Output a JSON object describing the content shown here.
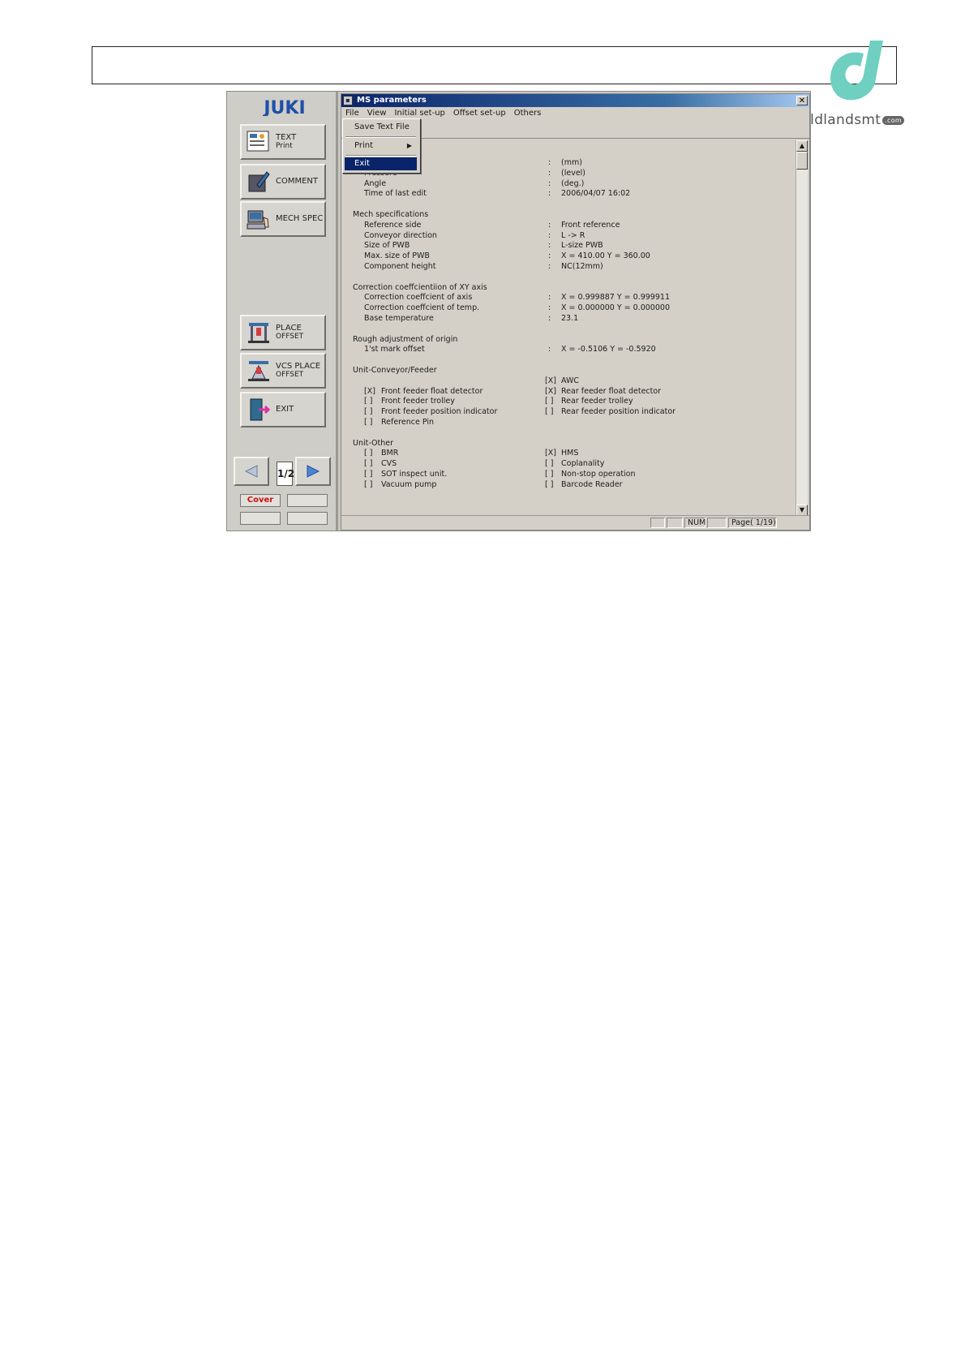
{
  "brand": {
    "name": "Goldlandsmt",
    "suffix": ".com"
  },
  "left_panel": {
    "logo": "JUKI",
    "buttons": [
      {
        "line1": "TEXT",
        "line2": "Print",
        "icon": "text-print-icon"
      },
      {
        "line1": "COMMENT",
        "line2": "",
        "icon": "comment-icon"
      },
      {
        "line1": "MECH SPEC",
        "line2": "",
        "icon": "mech-spec-icon"
      },
      {
        "line1": "PLACE",
        "line2": "OFFSET",
        "icon": "place-offset-icon"
      },
      {
        "line1": "VCS PLACE",
        "line2": "OFFSET",
        "icon": "vcs-place-offset-icon"
      },
      {
        "line1": "EXIT",
        "line2": "",
        "icon": "exit-door-icon"
      }
    ],
    "page_indicator": "1/2",
    "status": {
      "cover": "Cover"
    }
  },
  "window": {
    "title": "MS parameters",
    "menu": [
      "File",
      "View",
      "Initial set-up",
      "Offset set-up",
      "Others"
    ],
    "file_menu": {
      "save": "Save Text File",
      "print": "Print",
      "exit": "Exit"
    },
    "lines": [
      {
        "type": "kv",
        "label": "",
        "value": "(mm)"
      },
      {
        "type": "kv",
        "label": "Pressure",
        "value": "(level)"
      },
      {
        "type": "kv",
        "label": "Angle",
        "value": "(deg.)"
      },
      {
        "type": "kv",
        "label": "Time of last edit",
        "value": "2006/04/07 16:02"
      },
      {
        "type": "blank"
      },
      {
        "type": "section",
        "label": "Mech specifications"
      },
      {
        "type": "kv",
        "label": "Reference side",
        "value": "Front reference"
      },
      {
        "type": "kv",
        "label": "Conveyor direction",
        "value": "L -> R"
      },
      {
        "type": "kv",
        "label": "Size of PWB",
        "value": "L-size PWB"
      },
      {
        "type": "kv",
        "label": "Max. size of PWB",
        "value": "X =  410.00  Y =  360.00"
      },
      {
        "type": "kv",
        "label": "Component height",
        "value": "NC(12mm)"
      },
      {
        "type": "blank"
      },
      {
        "type": "section",
        "label": "Correction coeffcientiion of XY axis"
      },
      {
        "type": "kv",
        "label": "Correction coeffcient of axis",
        "value": "X = 0.999887  Y = 0.999911"
      },
      {
        "type": "kv",
        "label": "Correction coeffcient of temp.",
        "value": "X = 0.000000  Y = 0.000000"
      },
      {
        "type": "kv",
        "label": "Base temperature",
        "value": "23.1"
      },
      {
        "type": "blank"
      },
      {
        "type": "section",
        "label": "Rough adjustment of origin"
      },
      {
        "type": "kv",
        "label": "1'st mark offset",
        "value": "X =  -0.5106  Y =  -0.5920"
      },
      {
        "type": "blank"
      },
      {
        "type": "section",
        "label": "Unit-Conveyor/Feeder"
      },
      {
        "type": "chk",
        "l_mark": "",
        "l_label": "",
        "r_mark": "[X]",
        "r_label": "AWC"
      },
      {
        "type": "chk",
        "l_mark": "[X]",
        "l_label": "Front feeder float detector",
        "r_mark": "[X]",
        "r_label": "Rear feeder float detector"
      },
      {
        "type": "chk",
        "l_mark": "[  ]",
        "l_label": "Front feeder trolley",
        "r_mark": "[  ]",
        "r_label": "Rear feeder trolley"
      },
      {
        "type": "chk",
        "l_mark": "[  ]",
        "l_label": "Front feeder position indicator",
        "r_mark": "[  ]",
        "r_label": "Rear feeder position indicator"
      },
      {
        "type": "chk",
        "l_mark": "[  ]",
        "l_label": "Reference Pin",
        "r_mark": "",
        "r_label": ""
      },
      {
        "type": "blank"
      },
      {
        "type": "section",
        "label": "Unit-Other"
      },
      {
        "type": "chk",
        "l_mark": "[  ]",
        "l_label": "BMR",
        "r_mark": "[X]",
        "r_label": "HMS"
      },
      {
        "type": "chk",
        "l_mark": "[  ]",
        "l_label": "CVS",
        "r_mark": "[  ]",
        "r_label": "Coplanality"
      },
      {
        "type": "chk",
        "l_mark": "[  ]",
        "l_label": "SOT inspect unit.",
        "r_mark": "[  ]",
        "r_label": "Non-stop operation"
      },
      {
        "type": "chk",
        "l_mark": "[  ]",
        "l_label": "Vacuum pump",
        "r_mark": "[  ]",
        "r_label": "Barcode Reader"
      }
    ],
    "status_bar": {
      "num": "NUM",
      "page": "Page( 1/19)"
    }
  }
}
